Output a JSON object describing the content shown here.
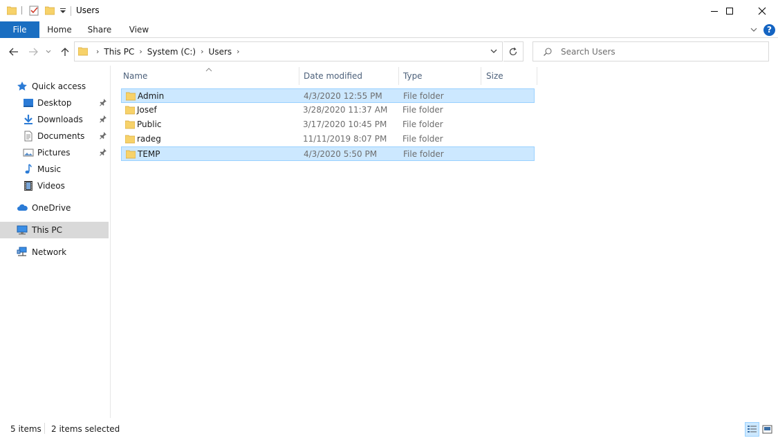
{
  "window": {
    "title": "Users",
    "controls": [
      "minimize",
      "maximize",
      "close"
    ]
  },
  "ribbon": {
    "tabs": [
      {
        "label": "File",
        "active": true
      },
      {
        "label": "Home"
      },
      {
        "label": "Share"
      },
      {
        "label": "View"
      }
    ],
    "help_label": "?"
  },
  "address": {
    "crumbs": [
      "This PC",
      "System (C:)",
      "Users"
    ]
  },
  "search": {
    "placeholder": "Search Users"
  },
  "nav": {
    "items": [
      {
        "label": "Quick access",
        "icon": "star-icon",
        "pinned": false
      },
      {
        "label": "Desktop",
        "icon": "desktop-icon",
        "pinned": true
      },
      {
        "label": "Downloads",
        "icon": "download-arrow-icon",
        "pinned": true
      },
      {
        "label": "Documents",
        "icon": "document-icon",
        "pinned": true
      },
      {
        "label": "Pictures",
        "icon": "pictures-icon",
        "pinned": true
      },
      {
        "label": "Music",
        "icon": "music-note-icon",
        "pinned": false
      },
      {
        "label": "Videos",
        "icon": "film-icon",
        "pinned": false
      },
      {
        "label": "OneDrive",
        "icon": "cloud-icon",
        "pinned": false
      },
      {
        "label": "This PC",
        "icon": "computer-icon",
        "pinned": false,
        "selected": true
      },
      {
        "label": "Network",
        "icon": "network-icon",
        "pinned": false
      }
    ]
  },
  "columns": {
    "name": "Name",
    "date": "Date modified",
    "type": "Type",
    "size": "Size"
  },
  "files": [
    {
      "name": "Admin",
      "date": "4/3/2020 12:55 PM",
      "type": "File folder",
      "size": "",
      "selected": true
    },
    {
      "name": "Josef",
      "date": "3/28/2020 11:37 AM",
      "type": "File folder",
      "size": "",
      "selected": false
    },
    {
      "name": "Public",
      "date": "3/17/2020 10:45 PM",
      "type": "File folder",
      "size": "",
      "selected": false
    },
    {
      "name": "radeg",
      "date": "11/11/2019 8:07 PM",
      "type": "File folder",
      "size": "",
      "selected": false
    },
    {
      "name": "TEMP",
      "date": "4/3/2020 5:50 PM",
      "type": "File folder",
      "size": "",
      "selected": true
    }
  ],
  "status": {
    "count": "5 items",
    "selection": "2 items selected"
  },
  "colors": {
    "accent": "#1a6ec1",
    "selection_bg": "#cce8ff",
    "selection_border": "#99d1ff",
    "folder": "#f7d26a"
  }
}
